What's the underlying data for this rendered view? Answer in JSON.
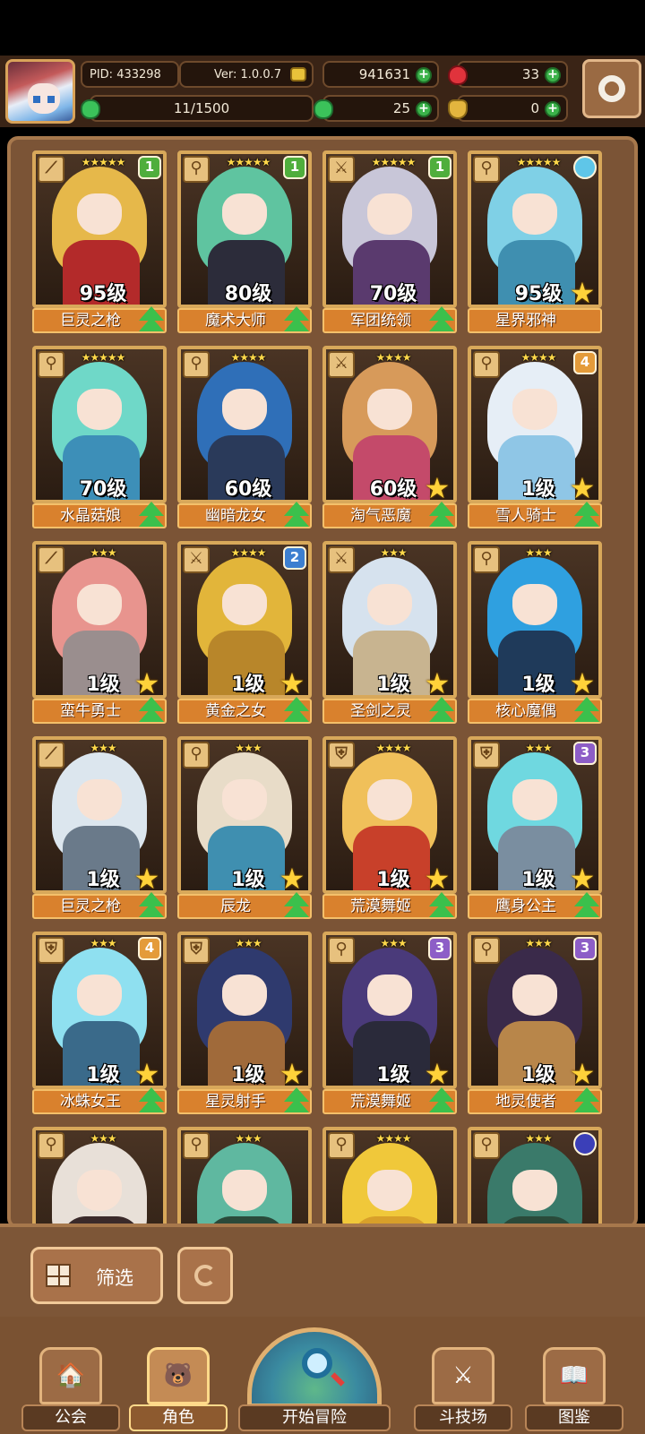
{
  "header": {
    "pid": "PID: 433298",
    "version": "Ver: 1.0.0.7",
    "gold": "941631",
    "ruby": "33",
    "energy": "11/1500",
    "clover": "25",
    "potion": "0"
  },
  "characters": [
    {
      "name": "巨灵之枪",
      "level": "95级",
      "stars": "★★★★★",
      "badge": "1",
      "badge_type": "green",
      "weapon": "spear",
      "hair": "#e6b84a",
      "body": "#b32a2a",
      "corner": "up"
    },
    {
      "name": "魔术大师",
      "level": "80级",
      "stars": "★★★★★",
      "badge": "1",
      "badge_type": "green",
      "weapon": "wand",
      "hair": "#5fc4a0",
      "body": "#2c2c3a",
      "corner": "up"
    },
    {
      "name": "军团统领",
      "level": "70级",
      "stars": "★★★★★",
      "badge": "1",
      "badge_type": "green",
      "weapon": "sword",
      "hair": "#c8c6d8",
      "body": "#5a3a6e",
      "corner": "up"
    },
    {
      "name": "星界邪神",
      "level": "95级",
      "stars": "★★★★★",
      "badge": "",
      "badge_type": "gem",
      "weapon": "wand",
      "hair": "#7fd0e6",
      "body": "#3f8fb0",
      "corner": "star"
    },
    {
      "name": "水晶菇娘",
      "level": "70级",
      "stars": "★★★★★",
      "badge": "",
      "badge_type": "",
      "weapon": "wand",
      "hair": "#6fd8c8",
      "body": "#3d8fb8",
      "corner": "up"
    },
    {
      "name": "幽暗龙女",
      "level": "60级",
      "stars": "★★★★",
      "badge": "",
      "badge_type": "",
      "weapon": "wand",
      "hair": "#2f6fb8",
      "body": "#2a3a5a",
      "corner": "up"
    },
    {
      "name": "淘气恶魔",
      "level": "60级",
      "stars": "★★★★",
      "badge": "",
      "badge_type": "",
      "weapon": "sword",
      "hair": "#d79a5a",
      "body": "#c44a6a",
      "corner": "both"
    },
    {
      "name": "雪人骑士",
      "level": "1级",
      "stars": "★★★★",
      "badge": "4",
      "badge_type": "orange",
      "weapon": "wand",
      "hair": "#e6eef6",
      "body": "#8fc6e6",
      "corner": "both"
    },
    {
      "name": "蛮牛勇士",
      "level": "1级",
      "stars": "★★★",
      "badge": "",
      "badge_type": "",
      "weapon": "spear",
      "hair": "#e8948e",
      "body": "#9a8e8e",
      "corner": "both"
    },
    {
      "name": "黄金之女",
      "level": "1级",
      "stars": "★★★★",
      "badge": "2",
      "badge_type": "blue",
      "weapon": "sword",
      "hair": "#e2b53a",
      "body": "#b8862a",
      "corner": "both"
    },
    {
      "name": "圣剑之灵",
      "level": "1级",
      "stars": "★★★",
      "badge": "",
      "badge_type": "",
      "weapon": "sword",
      "hair": "#d6e2ee",
      "body": "#c8b490",
      "corner": "both"
    },
    {
      "name": "核心魔偶",
      "level": "1级",
      "stars": "★★★",
      "badge": "",
      "badge_type": "",
      "weapon": "wand",
      "hair": "#2fa0e0",
      "body": "#1f3a5a",
      "corner": "both"
    },
    {
      "name": "巨灵之枪",
      "level": "1级",
      "stars": "★★★",
      "badge": "",
      "badge_type": "",
      "weapon": "spear",
      "hair": "#dce6ee",
      "body": "#6a7a8a",
      "corner": "both"
    },
    {
      "name": "辰龙",
      "level": "1级",
      "stars": "★★★",
      "badge": "",
      "badge_type": "",
      "weapon": "wand",
      "hair": "#e8dcc8",
      "body": "#3f8fb0",
      "corner": "both"
    },
    {
      "name": "荒漠舞姬",
      "level": "1级",
      "stars": "★★★★",
      "badge": "",
      "badge_type": "",
      "weapon": "shield",
      "hair": "#f0c05a",
      "body": "#c8402a",
      "corner": "both"
    },
    {
      "name": "鹰身公主",
      "level": "1级",
      "stars": "★★★",
      "badge": "3",
      "badge_type": "purple",
      "weapon": "shield",
      "hair": "#6fd8e0",
      "body": "#7a8ea0",
      "corner": "both"
    },
    {
      "name": "冰蛛女王",
      "level": "1级",
      "stars": "★★★",
      "badge": "4",
      "badge_type": "orange",
      "weapon": "shield",
      "hair": "#8fe0f0",
      "body": "#3a6a8a",
      "corner": "both"
    },
    {
      "name": "星灵射手",
      "level": "1级",
      "stars": "★★★",
      "badge": "",
      "badge_type": "",
      "weapon": "shield",
      "hair": "#2f3a6e",
      "body": "#a06a3a",
      "corner": "both"
    },
    {
      "name": "荒漠舞姬",
      "level": "1级",
      "stars": "★★★",
      "badge": "3",
      "badge_type": "purple",
      "weapon": "wand",
      "hair": "#4a3a7a",
      "body": "#2a2a3a",
      "corner": "both"
    },
    {
      "name": "地灵使者",
      "level": "1级",
      "stars": "★★★",
      "badge": "3",
      "badge_type": "purple",
      "weapon": "wand",
      "hair": "#3a2a4a",
      "body": "#b8864a",
      "corner": "both"
    },
    {
      "name": "",
      "level": "",
      "stars": "★★★",
      "badge": "",
      "badge_type": "",
      "weapon": "wand",
      "hair": "#e8e0d8",
      "body": "#3a2a2a",
      "corner": "none"
    },
    {
      "name": "",
      "level": "",
      "stars": "★★★",
      "badge": "",
      "badge_type": "",
      "weapon": "wand",
      "hair": "#5fb8a0",
      "body": "#2a4a3a",
      "corner": "none"
    },
    {
      "name": "",
      "level": "",
      "stars": "★★★★",
      "badge": "",
      "badge_type": "",
      "weapon": "wand",
      "hair": "#f0c83a",
      "body": "#d8a02a",
      "corner": "none"
    },
    {
      "name": "",
      "level": "",
      "stars": "★★★",
      "badge": "",
      "badge_type": "orb",
      "weapon": "wand",
      "hair": "#3a7a6a",
      "body": "#2a4a3a",
      "corner": "none"
    }
  ],
  "filter": {
    "label": "筛选"
  },
  "nav": {
    "guild": "公会",
    "character": "角色",
    "adventure": "开始冒险",
    "arena": "斗技场",
    "codex": "图鉴"
  },
  "colors": {
    "accent": "#d9812d",
    "panel": "#7b5436",
    "upgrade": "#3bc04c"
  }
}
